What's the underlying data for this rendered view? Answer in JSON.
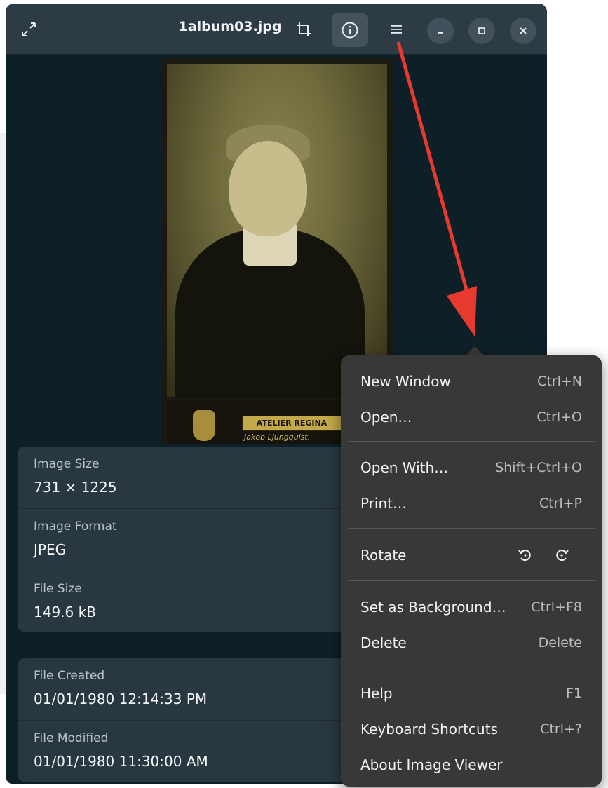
{
  "window": {
    "title": "1album03.jpg"
  },
  "headerbar": {
    "fullscreen_icon": "expand-icon",
    "crop_icon": "crop-icon",
    "info_icon": "info-icon",
    "menu_icon": "hamburger-menu-icon",
    "minimize_icon": "minimize-icon",
    "maximize_icon": "maximize-icon",
    "close_icon": "close-icon"
  },
  "image": {
    "atelier_text": "ATELIER REGINA",
    "photographer_text": "Jakob Ljungquist."
  },
  "properties": {
    "group1": [
      {
        "label": "Image Size",
        "value": "731 × 1225"
      },
      {
        "label": "Image Format",
        "value": "JPEG"
      },
      {
        "label": "File Size",
        "value": "149.6 kB"
      }
    ],
    "group2": [
      {
        "label": "File Created",
        "value": "01/01/1980 12:14:33 PM"
      },
      {
        "label": "File Modified",
        "value": "01/01/1980 11:30:00 AM"
      }
    ]
  },
  "menu": {
    "items": [
      {
        "label": "New Window",
        "accel": "Ctrl+N"
      },
      {
        "label": "Open…",
        "accel": "Ctrl+O"
      },
      {
        "label": "Open With…",
        "accel": "Shift+Ctrl+O"
      },
      {
        "label": "Print…",
        "accel": "Ctrl+P"
      },
      {
        "label": "Rotate",
        "accel": ""
      },
      {
        "label": "Set as Background…",
        "accel": "Ctrl+F8"
      },
      {
        "label": "Delete",
        "accel": "Delete"
      },
      {
        "label": "Help",
        "accel": "F1"
      },
      {
        "label": "Keyboard Shortcuts",
        "accel": "Ctrl+?"
      },
      {
        "label": "About Image Viewer",
        "accel": ""
      }
    ],
    "rotate_left_icon": "rotate-left-icon",
    "rotate_right_icon": "rotate-right-icon"
  },
  "colors": {
    "headerbar": "#2d3b44",
    "canvas": "#0d2028",
    "popover": "#383838",
    "annotation_arrow": "#e8392f"
  }
}
